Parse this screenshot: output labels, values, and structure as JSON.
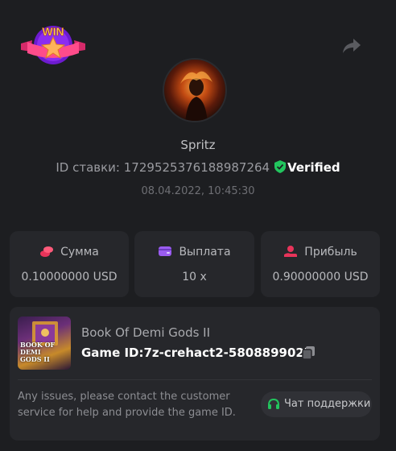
{
  "badge": {
    "text": "WIN"
  },
  "user": {
    "name": "Spritz"
  },
  "bet": {
    "id_label": "ID ставки:",
    "id_value": "1729525376188987264",
    "verified_label": "Verified",
    "datetime": "08.04.2022, 10:45:30"
  },
  "stats": [
    {
      "label": "Сумма",
      "value": "0.10000000 USD",
      "icon": "coins-icon",
      "icon_color": "#e8345a"
    },
    {
      "label": "Выплата",
      "value": "10 x",
      "icon": "wallet-icon",
      "icon_color": "#9a5cf0"
    },
    {
      "label": "Прибыль",
      "value": "0.90000000 USD",
      "icon": "hand-coin-icon",
      "icon_color": "#e8345a"
    }
  ],
  "game": {
    "title": "Book Of Demi Gods II",
    "thumb_text": "BOOK OF DEMI GODS II",
    "id_label": "Game ID:",
    "id_value": "7z-crehact2-5808899027"
  },
  "support": {
    "text": "Any issues, please contact the customer service for help and provide the game ID.",
    "button_label": "Чат поддержки"
  },
  "colors": {
    "background": "#1d1e21",
    "card": "#26272b",
    "verified_green": "#22c55e",
    "support_green": "#22c55e"
  }
}
